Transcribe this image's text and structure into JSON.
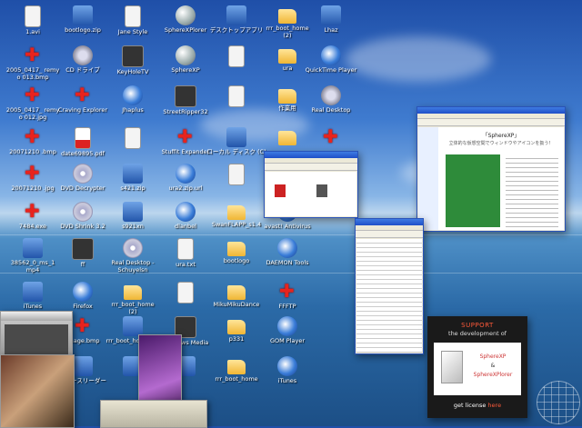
{
  "desktop": {
    "icons": [
      {
        "label": "1.avi",
        "icon": "file-icon",
        "kind": "file",
        "col": 0,
        "row": 0
      },
      {
        "label": "bootlogo.zip",
        "icon": "zip-icon",
        "kind": "app",
        "col": 1,
        "row": 0
      },
      {
        "label": "Jane Style",
        "icon": "app-icon",
        "kind": "file",
        "col": 2,
        "row": 0
      },
      {
        "label": "SphereXPlorer",
        "icon": "sphere-icon",
        "kind": "sphere",
        "col": 3,
        "row": 0
      },
      {
        "label": "デスクトップアプリ",
        "icon": "app-icon",
        "kind": "app",
        "col": 4,
        "row": 0
      },
      {
        "label": "rrr_boot_home\n(2)",
        "icon": "folder-icon",
        "kind": "folder",
        "col": 5,
        "row": 0
      },
      {
        "label": "Lhaz",
        "icon": "app-icon",
        "kind": "app",
        "col": 6,
        "row": 0
      },
      {
        "label": "2005_0417_ remy\no 013.bmp",
        "icon": "red-star-icon",
        "kind": "red-star",
        "col": 0,
        "row": 1
      },
      {
        "label": "CD ドライブ",
        "icon": "cd-icon",
        "kind": "gear",
        "col": 1,
        "row": 1
      },
      {
        "label": "KeyHoleTV",
        "icon": "tv-icon",
        "kind": "dark",
        "col": 2,
        "row": 1
      },
      {
        "label": "SphereXP",
        "icon": "sphere-icon",
        "kind": "sphere",
        "col": 3,
        "row": 1
      },
      {
        "label": "",
        "icon": "file-icon",
        "kind": "file",
        "col": 4,
        "row": 1
      },
      {
        "label": "ura",
        "icon": "folder-icon",
        "kind": "folder",
        "col": 5,
        "row": 1
      },
      {
        "label": "QuickTime Player",
        "icon": "quicktime-icon",
        "kind": "globe",
        "col": 6,
        "row": 1
      },
      {
        "label": "2005_0417_ remy\no 012.jpg",
        "icon": "red-star-icon",
        "kind": "red-star",
        "col": 0,
        "row": 2
      },
      {
        "label": "Craving Explorer",
        "icon": "app-icon",
        "kind": "red-star",
        "col": 1,
        "row": 2
      },
      {
        "label": "Jhaplus",
        "icon": "app-icon",
        "kind": "globe",
        "col": 2,
        "row": 2
      },
      {
        "label": "StreetRipper32",
        "icon": "app-icon",
        "kind": "dark",
        "col": 3,
        "row": 2
      },
      {
        "label": "",
        "icon": "file-icon",
        "kind": "file",
        "col": 4,
        "row": 2
      },
      {
        "label": "作業用",
        "icon": "folder-icon",
        "kind": "folder",
        "col": 5,
        "row": 2
      },
      {
        "label": "Real Desktop",
        "icon": "app-icon",
        "kind": "gear",
        "col": 6,
        "row": 2
      },
      {
        "label": "20071210 .bmp",
        "icon": "red-star-icon",
        "kind": "red-star",
        "col": 0,
        "row": 3
      },
      {
        "label": "date69895.pdf",
        "icon": "pdf-icon",
        "kind": "pdf",
        "col": 1,
        "row": 3
      },
      {
        "label": "",
        "icon": "file-icon",
        "kind": "file",
        "col": 2,
        "row": 3
      },
      {
        "label": "Stuffit Expander",
        "icon": "app-icon",
        "kind": "red-star",
        "col": 3,
        "row": 3
      },
      {
        "label": "ローカル ディスク (C)",
        "icon": "disk-icon",
        "kind": "app",
        "col": 4,
        "row": 3
      },
      {
        "label": "",
        "icon": "folder-icon",
        "kind": "folder",
        "col": 5,
        "row": 3
      },
      {
        "label": "",
        "icon": "app-icon",
        "kind": "red-star",
        "col": 6,
        "row": 3
      },
      {
        "label": "20071210 .jpg",
        "icon": "red-star-icon",
        "kind": "red-star",
        "col": 0,
        "row": 4
      },
      {
        "label": "DVD Decrypter",
        "icon": "dvd-icon",
        "kind": "disc",
        "col": 1,
        "row": 4
      },
      {
        "label": "s421.zip",
        "icon": "zip-icon",
        "kind": "app",
        "col": 2,
        "row": 4
      },
      {
        "label": "ura2.zip.url",
        "icon": "firefox-icon",
        "kind": "globe",
        "col": 3,
        "row": 4
      },
      {
        "label": "",
        "icon": "file-icon",
        "kind": "file",
        "col": 4,
        "row": 4
      },
      {
        "label": "7484.exe",
        "icon": "red-star-icon",
        "kind": "red-star",
        "col": 0,
        "row": 5
      },
      {
        "label": "DVD Shrink 3.2",
        "icon": "dvd-icon",
        "kind": "disc",
        "col": 1,
        "row": 5
      },
      {
        "label": "s921xn",
        "icon": "app-icon",
        "kind": "app",
        "col": 2,
        "row": 5
      },
      {
        "label": "dlanbel",
        "icon": "firefox-icon",
        "kind": "globe",
        "col": 3,
        "row": 5
      },
      {
        "label": "SwanFLAPP_s1.4",
        "icon": "folder-icon",
        "kind": "folder",
        "col": 4,
        "row": 5
      },
      {
        "label": "avast! Antivirus",
        "icon": "app-icon",
        "kind": "globe",
        "col": 5,
        "row": 5
      },
      {
        "label": "38562_0_ms_1\nmp4",
        "icon": "app-icon",
        "kind": "app",
        "col": 0,
        "row": 6
      },
      {
        "label": "ff",
        "icon": "app-icon",
        "kind": "dark",
        "col": 1,
        "row": 6
      },
      {
        "label": "Real Desktop -\nSchuyelsn",
        "icon": "app-icon",
        "kind": "disc",
        "col": 2,
        "row": 6
      },
      {
        "label": "ura.txt",
        "icon": "file-icon",
        "kind": "file",
        "col": 3,
        "row": 6
      },
      {
        "label": "bootlogo",
        "icon": "folder-icon",
        "kind": "folder",
        "col": 4,
        "row": 6
      },
      {
        "label": "DAEMON Tools",
        "icon": "app-icon",
        "kind": "globe",
        "col": 5,
        "row": 6
      },
      {
        "label": "iTunes",
        "icon": "app-icon",
        "kind": "app",
        "col": 0,
        "row": 7
      },
      {
        "label": "Firefox",
        "icon": "firefox-icon",
        "kind": "globe",
        "col": 1,
        "row": 7
      },
      {
        "label": "rrr_boot_home\n(2)",
        "icon": "folder-icon",
        "kind": "folder",
        "col": 2,
        "row": 7
      },
      {
        "label": "",
        "icon": "file-icon",
        "kind": "file",
        "col": 3,
        "row": 7
      },
      {
        "label": "MikuMikuDance",
        "icon": "folder-icon",
        "kind": "folder",
        "col": 4,
        "row": 7
      },
      {
        "label": "FFFTP",
        "icon": "app-icon",
        "kind": "red-star",
        "col": 5,
        "row": 7
      },
      {
        "label": "",
        "icon": "app-icon",
        "kind": "app",
        "col": 0,
        "row": 8
      },
      {
        "label": "Image.bmp",
        "icon": "red-star-icon",
        "kind": "red-star",
        "col": 1,
        "row": 8
      },
      {
        "label": "rrr_boot_home.lzh",
        "icon": "app-icon",
        "kind": "app",
        "col": 2,
        "row": 8
      },
      {
        "label": "Windows Media",
        "icon": "app-icon",
        "kind": "dark",
        "col": 3,
        "row": 8
      },
      {
        "label": "p331",
        "icon": "folder-icon",
        "kind": "folder",
        "col": 4,
        "row": 8
      },
      {
        "label": "GOM Player",
        "icon": "app-icon",
        "kind": "globe",
        "col": 5,
        "row": 8
      },
      {
        "label": "",
        "icon": "red-star-icon",
        "kind": "red-star",
        "col": 0,
        "row": 9
      },
      {
        "label": "ニュースリーダー",
        "icon": "app-icon",
        "kind": "app",
        "col": 1,
        "row": 9
      },
      {
        "label": "",
        "icon": "app-icon",
        "kind": "app",
        "col": 2,
        "row": 9
      },
      {
        "label": "",
        "icon": "app-icon",
        "kind": "app",
        "col": 3,
        "row": 9
      },
      {
        "label": "rrr_boot_home",
        "icon": "folder-icon",
        "kind": "folder",
        "col": 4,
        "row": 9
      },
      {
        "label": "iTunes",
        "icon": "app-icon",
        "kind": "globe",
        "col": 5,
        "row": 9
      }
    ]
  },
  "windows": {
    "browser": {
      "title": "「SphereXP」",
      "subtitle": "立体的な仮想空間でウィンドウやアイコンを扱う！"
    },
    "explorer": {
      "title": ""
    },
    "editor": {
      "title": ""
    }
  },
  "support_banner": {
    "line1": "SUPPORT",
    "line2": "the development of",
    "product1": "SphereXP",
    "and": "&",
    "product2": "SphereXPlorer",
    "license_prefix": "get license",
    "license_link": "here"
  },
  "colors": {
    "sky_top": "#1f4fa8",
    "horizon": "#bcd6ee",
    "sea": "#1c4f86",
    "window_titlebar": "#2a53b8",
    "support_accent": "#ff5a3a"
  }
}
